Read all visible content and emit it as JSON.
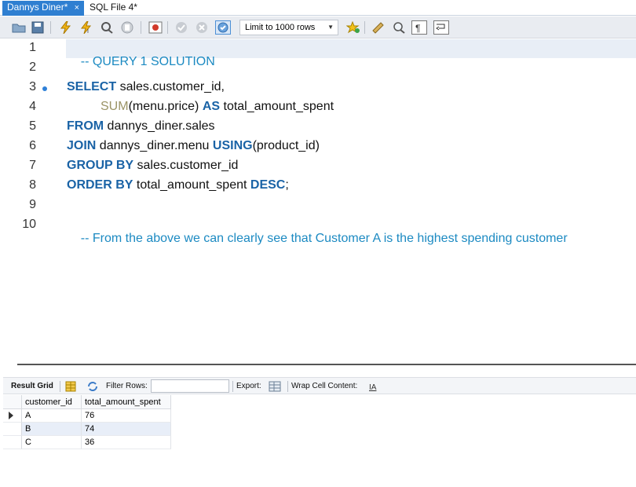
{
  "tabs": [
    {
      "label": "Dannys Diner*",
      "active": true
    },
    {
      "label": "SQL File 4*",
      "active": false
    }
  ],
  "tab_close_glyph": "×",
  "toolbar": {
    "icons": [
      "folder-open-icon",
      "save-icon",
      "execute-icon",
      "execute-current-icon",
      "explain-icon",
      "stop-icon",
      "toggle-error-icon",
      "commit-icon",
      "rollback-icon",
      "autocommit-icon",
      "beautify-icon",
      "find-icon",
      "invisible-chars-icon",
      "wrap-icon"
    ],
    "limit_label": "Limit to 1000 rows"
  },
  "editor": {
    "line_numbers": [
      "1",
      "2",
      "3",
      "4",
      "5",
      "6",
      "7",
      "8",
      "9",
      "10"
    ],
    "lines": {
      "l1": {
        "comment": "-- QUERY 1 SOLUTION"
      },
      "l3": {
        "kw1": "SELECT",
        "t1": " sales.customer_id,"
      },
      "l4": {
        "fn": "SUM",
        "t1": "(menu.price) ",
        "kw1": "AS",
        "t2": " total_amount_spent"
      },
      "l5": {
        "kw1": "FROM",
        "t1": " dannys_diner.sales"
      },
      "l6": {
        "kw1": "JOIN",
        "t1": " dannys_diner.menu ",
        "kw2": "USING",
        "t2": "(product_id)"
      },
      "l7": {
        "kw1": "GROUP BY",
        "t1": " sales.customer_id"
      },
      "l8": {
        "kw1": "ORDER BY",
        "t1": " total_amount_spent ",
        "kw2": "DESC",
        "t2": ";"
      },
      "l10": {
        "comment": "-- From the above we can clearly see that Customer A is the highest spending customer"
      }
    },
    "colors": {
      "keyword": "#1a63a6",
      "function": "#9b9466",
      "comment": "#1c8ac2"
    }
  },
  "results": {
    "result_grid_label": "Result Grid",
    "filter_label": "Filter Rows:",
    "filter_value": "",
    "export_label": "Export:",
    "wrap_label": "Wrap Cell Content:",
    "columns": [
      "customer_id",
      "total_amount_spent"
    ],
    "rows": [
      [
        "A",
        "76"
      ],
      [
        "B",
        "74"
      ],
      [
        "C",
        "36"
      ]
    ]
  }
}
